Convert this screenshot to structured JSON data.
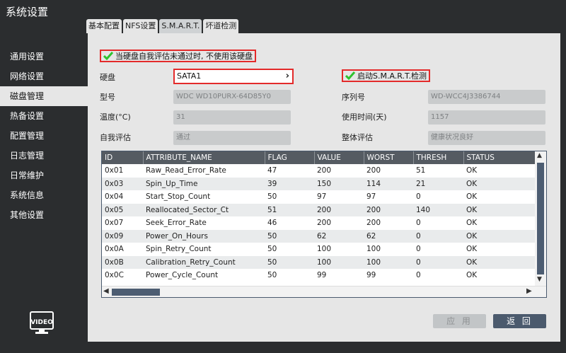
{
  "window": {
    "title": "系统设置"
  },
  "sidebar": {
    "items": [
      {
        "label": "通用设置",
        "active": false
      },
      {
        "label": "网络设置",
        "active": false
      },
      {
        "label": "磁盘管理",
        "active": true
      },
      {
        "label": "热备设置",
        "active": false
      },
      {
        "label": "配置管理",
        "active": false
      },
      {
        "label": "日志管理",
        "active": false
      },
      {
        "label": "日常维护",
        "active": false
      },
      {
        "label": "系统信息",
        "active": false
      },
      {
        "label": "其他设置",
        "active": false
      }
    ],
    "logo_text": "VIDEO"
  },
  "tabs": [
    {
      "label": "基本配置",
      "active": false
    },
    {
      "label": "NFS设置",
      "active": false
    },
    {
      "label": "S.M.A.R.T.",
      "active": true
    },
    {
      "label": "坏道检测",
      "active": false
    }
  ],
  "smart": {
    "skip_failed_label": "当硬盘自我评估未通过时, 不使用该硬盘",
    "enable_smart_label": "启动S.M.A.R.T.检测",
    "disk_label": "硬盘",
    "disk_value": "SATA1",
    "model_label": "型号",
    "model_value": "WDC WD10PURX-64D85Y0",
    "serial_label": "序列号",
    "serial_value": "WD-WCC4J3386744",
    "temp_label": "温度(°C)",
    "temp_value": "31",
    "usage_label": "使用时间(天)",
    "usage_value": "1157",
    "self_eval_label": "自我评估",
    "self_eval_value": "通过",
    "overall_label": "整体评估",
    "overall_value": "健康状况良好"
  },
  "table": {
    "columns": [
      "ID",
      "ATTRIBUTE_NAME",
      "FLAG",
      "VALUE",
      "WORST",
      "THRESH",
      "STATUS"
    ],
    "rows": [
      [
        "0x01",
        "Raw_Read_Error_Rate",
        "47",
        "200",
        "200",
        "51",
        "OK"
      ],
      [
        "0x03",
        "Spin_Up_Time",
        "39",
        "150",
        "114",
        "21",
        "OK"
      ],
      [
        "0x04",
        "Start_Stop_Count",
        "50",
        "97",
        "97",
        "0",
        "OK"
      ],
      [
        "0x05",
        "Reallocated_Sector_Ct",
        "51",
        "200",
        "200",
        "140",
        "OK"
      ],
      [
        "0x07",
        "Seek_Error_Rate",
        "46",
        "200",
        "200",
        "0",
        "OK"
      ],
      [
        "0x09",
        "Power_On_Hours",
        "50",
        "62",
        "62",
        "0",
        "OK"
      ],
      [
        "0x0A",
        "Spin_Retry_Count",
        "50",
        "100",
        "100",
        "0",
        "OK"
      ],
      [
        "0x0B",
        "Calibration_Retry_Count",
        "50",
        "100",
        "100",
        "0",
        "OK"
      ],
      [
        "0x0C",
        "Power_Cycle_Count",
        "50",
        "99",
        "99",
        "0",
        "OK"
      ]
    ]
  },
  "buttons": {
    "apply_label": "应 用",
    "back_label": "返 回"
  },
  "colors": {
    "accent_check": "#2fc22f",
    "highlight_border": "#e32a2a",
    "header_dark": "#555b62"
  }
}
